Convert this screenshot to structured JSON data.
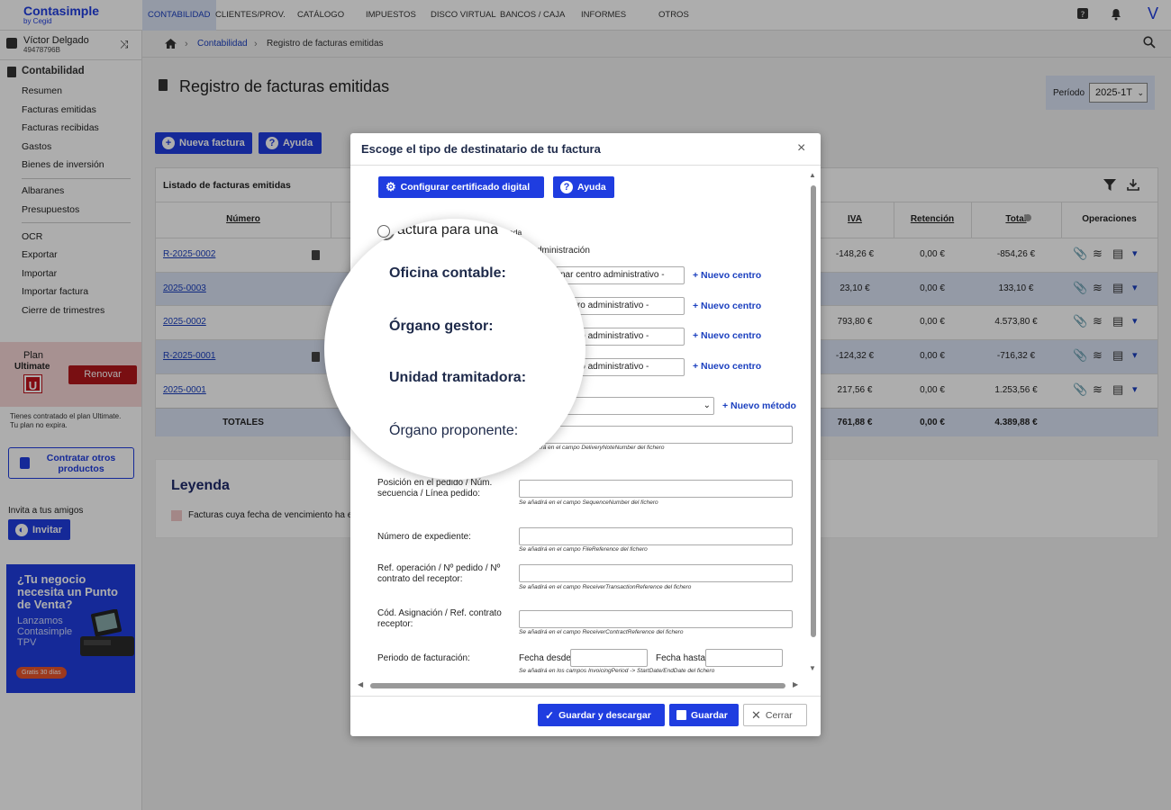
{
  "brand": {
    "name": "Contasimple",
    "by": "by Cegid"
  },
  "nav": [
    "CONTABILIDAD",
    "CLIENTES/PROV.",
    "CATÁLOGO",
    "IMPUESTOS",
    "DISCO VIRTUAL",
    "BANCOS / CAJA",
    "INFORMES",
    "OTROS"
  ],
  "user": {
    "name": "Víctor Delgado",
    "id": "49478796B"
  },
  "sidebar": {
    "section": "Contabilidad",
    "items1": [
      "Resumen",
      "Facturas emitidas",
      "Facturas recibidas",
      "Gastos",
      "Bienes de inversión"
    ],
    "items2": [
      "Albaranes",
      "Presupuestos"
    ],
    "items3": [
      "OCR",
      "Exportar",
      "Importar",
      "Importar factura",
      "Cierre de trimestres"
    ],
    "plan": {
      "label": "Plan",
      "name": "Ultimate",
      "renew": "Renovar",
      "note1": "Tienes contratado el plan Ultimate.",
      "note2": "Tu plan no expira."
    },
    "contract_btn1": "Contratar otros",
    "contract_btn2": "productos",
    "invite_text": "Invita a tus amigos",
    "invite_btn": "Invitar",
    "ad": {
      "l1": "¿Tu negocio",
      "l2": "necesita un Punto",
      "l3": "de Venta?",
      "l4": "Lanzamos",
      "l5": "Contasimple",
      "l6": "TPV",
      "badge": "Gratis 30 días"
    }
  },
  "breadcrumb": {
    "item1": "Contabilidad",
    "item2": "Registro de facturas emitidas"
  },
  "page": {
    "title": "Registro de facturas emitidas",
    "period_label": "Período",
    "period_value": "2025-1T",
    "new_btn": "Nueva factura",
    "help_btn": "Ayuda"
  },
  "list": {
    "title": "Listado de facturas emitidas",
    "headers": {
      "numero": "Número",
      "iva": "IVA",
      "retencion": "Retención",
      "total": "Total",
      "operaciones": "Operaciones"
    },
    "rows": [
      {
        "num": "R-2025-0002",
        "iva": "-148,26 €",
        "ret": "0,00 €",
        "total": "-854,26 €"
      },
      {
        "num": "2025-0003",
        "iva": "23,10 €",
        "ret": "0,00 €",
        "total": "133,10 €"
      },
      {
        "num": "2025-0002",
        "iva": "793,80 €",
        "ret": "0,00 €",
        "total": "4.573,80 €"
      },
      {
        "num": "R-2025-0001",
        "iva": "-124,32 €",
        "ret": "0,00 €",
        "total": "-716,32 €"
      },
      {
        "num": "2025-0001",
        "iva": "217,56 €",
        "ret": "0,00 €",
        "total": "1.253,56 €"
      }
    ],
    "totals": {
      "label": "TOTALES",
      "iva": "761,88 €",
      "ret": "0,00 €",
      "total": "4.389,88 €"
    }
  },
  "legend": {
    "title": "Leyenda",
    "item": "Facturas cuya fecha de vencimiento ha e"
  },
  "modal": {
    "title": "Escoge el tipo de destinatario de tu factura",
    "cert_btn": "Configurar certificado digital",
    "help_btn": "Ayuda",
    "radio_partial": "ada",
    "admin_partial": "dministración",
    "select_partial1": "nar centro administrativo -",
    "select_partial2": "centro administrativo -",
    "new_center": "+ Nuevo centro",
    "new_method": "+ Nuevo método",
    "hint_delivery": "se añadirá en el campo DeliveryNoteNumber del fichero",
    "pos_label1": "Posición en el pedido / Núm.",
    "pos_label2": "secuencia / Línea pedido:",
    "hint_seq": "Se añadirá en el campo SequenceNumber del fichero",
    "exp_label": "Número de expediente:",
    "hint_file": "Se añadirá en el campo FileReference del fichero",
    "ref_label1": "Ref. operación / Nº pedido / Nº",
    "ref_label2": "contrato del receptor:",
    "hint_rtr": "Se añadirá en el campo ReceiverTransactionReference del fichero",
    "cod_label1": "Cód. Asignación / Ref. contrato",
    "cod_label2": "receptor:",
    "hint_rcr": "Se añadirá en el campo ReceiverContractReference del fichero",
    "period_label": "Periodo de facturación:",
    "from_label": "Fecha desde:",
    "to_label": "Fecha hasta:",
    "hint_period": "Se añadirá en los campos InvoicingPeriod -> StartDate/EndDate del fichero",
    "save_dl": "Guardar y descargar",
    "save": "Guardar",
    "close": "Cerrar"
  },
  "magnifier": {
    "radio": "actura para una",
    "oficina": "Oficina contable:",
    "organo": "Órgano gestor:",
    "unidad": "Unidad tramitadora:",
    "proponente": "Órgano proponente:"
  }
}
